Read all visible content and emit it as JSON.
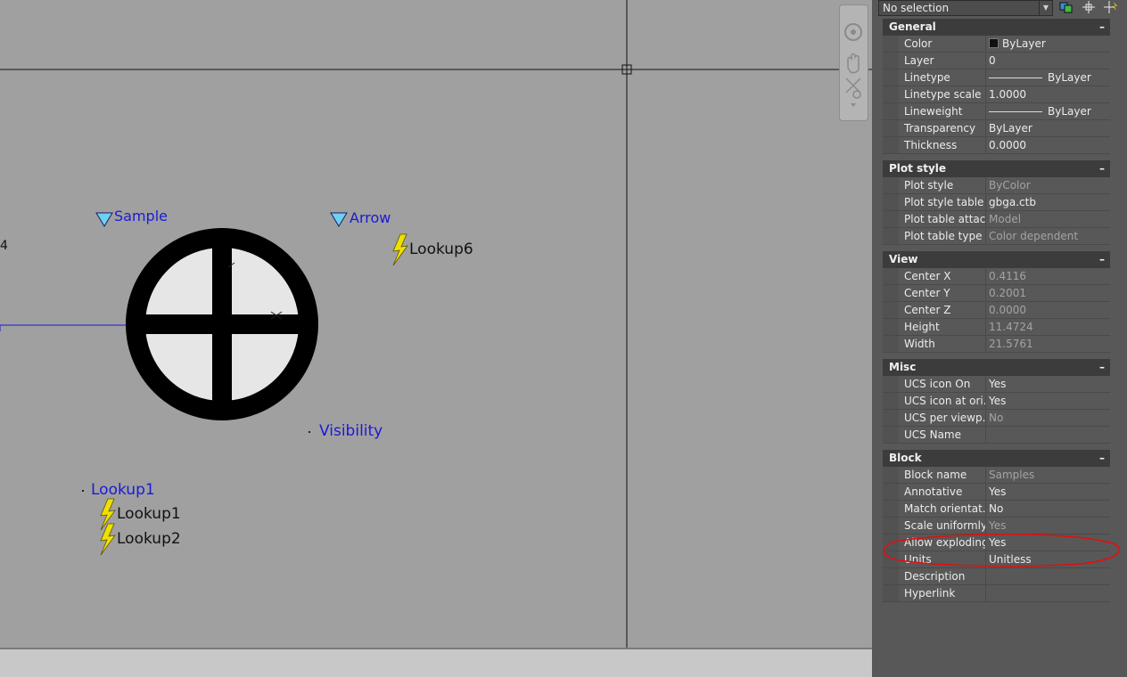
{
  "canvas": {
    "labels": {
      "sample": "Sample",
      "arrow": "Arrow",
      "lookup6": "Lookup6",
      "visibility": "Visibility",
      "lookup1_param": "Lookup1",
      "lookup1_action": "Lookup1",
      "lookup2_action": "Lookup2",
      "cut_text": "4"
    }
  },
  "palette": {
    "selection": "No selection",
    "groups": [
      {
        "title": "General",
        "toggle": "–",
        "rows": [
          {
            "name": "Color",
            "value": "ByLayer",
            "swatch": "#111111"
          },
          {
            "name": "Layer",
            "value": "0"
          },
          {
            "name": "Linetype",
            "value": "ByLayer",
            "line": true
          },
          {
            "name": "Linetype scale",
            "value": "1.0000"
          },
          {
            "name": "Lineweight",
            "value": "ByLayer",
            "line": true
          },
          {
            "name": "Transparency",
            "value": "ByLayer"
          },
          {
            "name": "Thickness",
            "value": "0.0000"
          }
        ]
      },
      {
        "title": "Plot style",
        "toggle": "–",
        "rows": [
          {
            "name": "Plot style",
            "value": "ByColor",
            "readonly": true
          },
          {
            "name": "Plot style table",
            "value": "gbga.ctb"
          },
          {
            "name": "Plot table attac...",
            "value": "Model",
            "readonly": true
          },
          {
            "name": "Plot table type",
            "value": "Color dependent",
            "readonly": true
          }
        ]
      },
      {
        "title": "View",
        "toggle": "–",
        "rows": [
          {
            "name": "Center X",
            "value": "0.4116",
            "readonly": true
          },
          {
            "name": "Center Y",
            "value": "0.2001",
            "readonly": true
          },
          {
            "name": "Center Z",
            "value": "0.0000",
            "readonly": true
          },
          {
            "name": "Height",
            "value": "11.4724",
            "readonly": true
          },
          {
            "name": "Width",
            "value": "21.5761",
            "readonly": true
          }
        ]
      },
      {
        "title": "Misc",
        "toggle": "–",
        "rows": [
          {
            "name": "UCS icon On",
            "value": "Yes"
          },
          {
            "name": "UCS icon at ori...",
            "value": "Yes"
          },
          {
            "name": "UCS per viewp...",
            "value": "No",
            "readonly": true
          },
          {
            "name": "UCS Name",
            "value": ""
          }
        ]
      },
      {
        "title": "Block",
        "toggle": "–",
        "rows": [
          {
            "name": "Block name",
            "value": "Samples",
            "readonly": true
          },
          {
            "name": "Annotative",
            "value": "Yes"
          },
          {
            "name": "Match orientat...",
            "value": "No"
          },
          {
            "name": "Scale uniformly",
            "value": "Yes",
            "readonly": true
          },
          {
            "name": "Allow exploding",
            "value": "Yes"
          },
          {
            "name": "Units",
            "value": "Unitless"
          },
          {
            "name": "Description",
            "value": ""
          },
          {
            "name": "Hyperlink",
            "value": ""
          }
        ]
      }
    ]
  },
  "colors": {
    "canvas_bg": "#a0a0a0",
    "parameter_text": "#1a1ad8",
    "palette_bg": "#585858",
    "annotation_red": "#e01010"
  }
}
